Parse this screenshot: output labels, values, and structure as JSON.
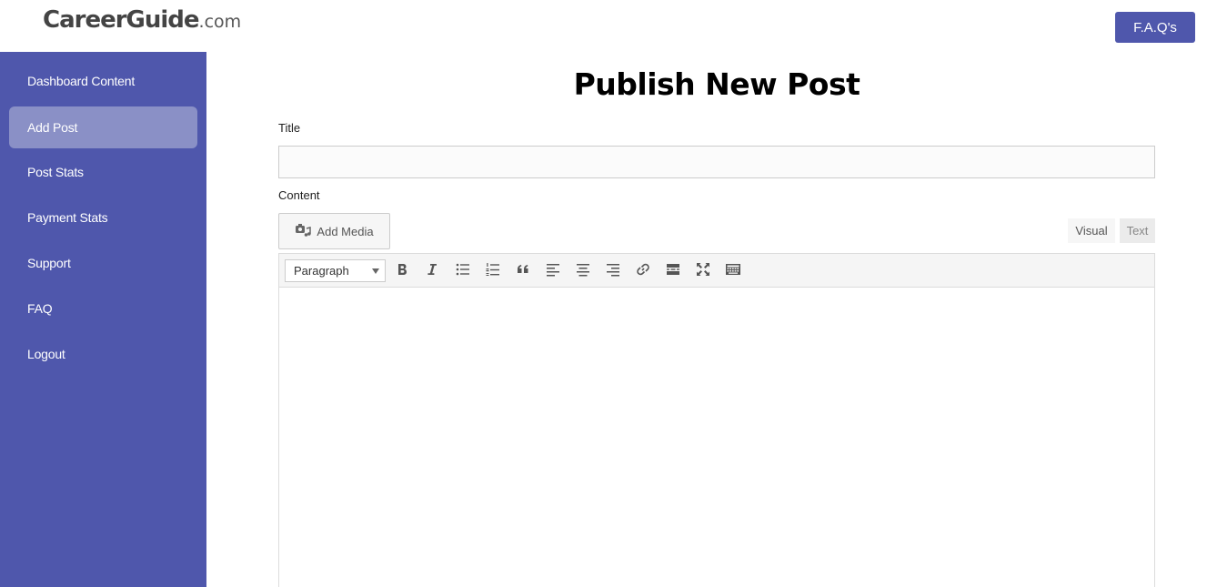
{
  "header": {
    "logo_main": "CareerGuide",
    "logo_tld": ".com",
    "faq_button": "F.A.Q's"
  },
  "sidebar": {
    "items": [
      {
        "label": "Dashboard Content"
      },
      {
        "label": "Add Post",
        "active": true
      },
      {
        "label": "Post Stats"
      },
      {
        "label": "Payment Stats"
      },
      {
        "label": "Support"
      },
      {
        "label": "FAQ"
      },
      {
        "label": "Logout"
      }
    ]
  },
  "main": {
    "title": "Publish New Post",
    "title_label": "Title",
    "title_value": "",
    "content_label": "Content",
    "add_media": "Add Media",
    "tabs": {
      "visual": "Visual",
      "text": "Text"
    },
    "format_select": "Paragraph",
    "toolbar_icons": [
      "bold-icon",
      "italic-icon",
      "bullet-list-icon",
      "numbered-list-icon",
      "blockquote-icon",
      "align-left-icon",
      "align-center-icon",
      "align-right-icon",
      "link-icon",
      "read-more-icon",
      "fullscreen-icon",
      "toolbar-toggle-icon"
    ]
  },
  "colors": {
    "brand": "#4f57ac",
    "nav_active": "#8a90c6"
  }
}
